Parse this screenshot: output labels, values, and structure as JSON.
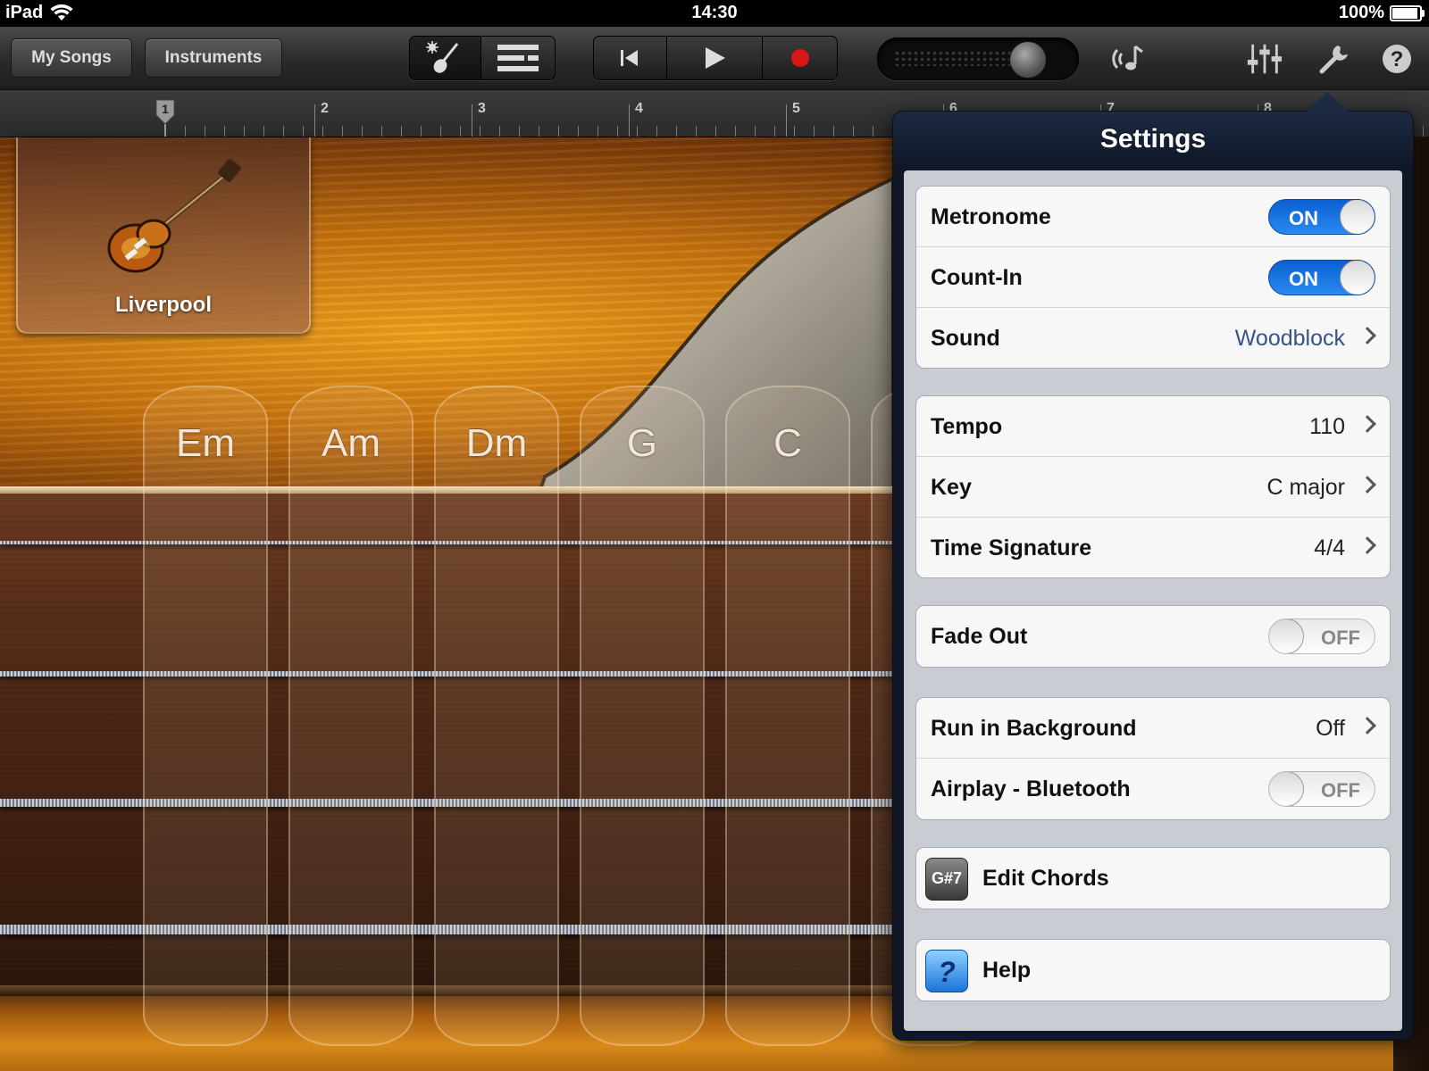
{
  "status_bar": {
    "device": "iPad",
    "time": "14:30",
    "battery": "100%",
    "battery_level": 1.0
  },
  "toolbar": {
    "my_songs_label": "My Songs",
    "instruments_label": "Instruments",
    "view_icons": [
      "guitar-chords-icon",
      "tracks-view-icon"
    ],
    "transport_icons": [
      "rewind-icon",
      "play-icon",
      "record-icon"
    ],
    "record_color": "#d91616",
    "volume_level": 0.82,
    "right_icons": [
      "loop-icon",
      "mixer-icon",
      "settings-wrench-icon",
      "help-icon"
    ]
  },
  "ruler": {
    "marks": [
      "1",
      "2",
      "3",
      "4",
      "5",
      "6",
      "7",
      "8"
    ]
  },
  "instrument": {
    "name": "Liverpool",
    "icon": "bass-guitar-icon"
  },
  "chords": [
    "Em",
    "Am",
    "Dm",
    "G",
    "C"
  ],
  "settings": {
    "title": "Settings",
    "metronome": {
      "label": "Metronome",
      "state": "ON"
    },
    "count_in": {
      "label": "Count-In",
      "state": "ON"
    },
    "sound": {
      "label": "Sound",
      "value": "Woodblock"
    },
    "tempo": {
      "label": "Tempo",
      "value": "110"
    },
    "key": {
      "label": "Key",
      "value": "C major"
    },
    "time_signature": {
      "label": "Time Signature",
      "value": "4/4"
    },
    "fade_out": {
      "label": "Fade Out",
      "state": "OFF"
    },
    "run_in_background": {
      "label": "Run in Background",
      "value": "Off"
    },
    "airplay_bluetooth": {
      "label": "Airplay - Bluetooth",
      "state": "OFF"
    },
    "edit_chords": {
      "label": "Edit Chords",
      "icon_text": "G#7"
    },
    "help": {
      "label": "Help",
      "icon_text": "?"
    },
    "accent_color": "#2a7ae8",
    "value_color": "#385487"
  }
}
